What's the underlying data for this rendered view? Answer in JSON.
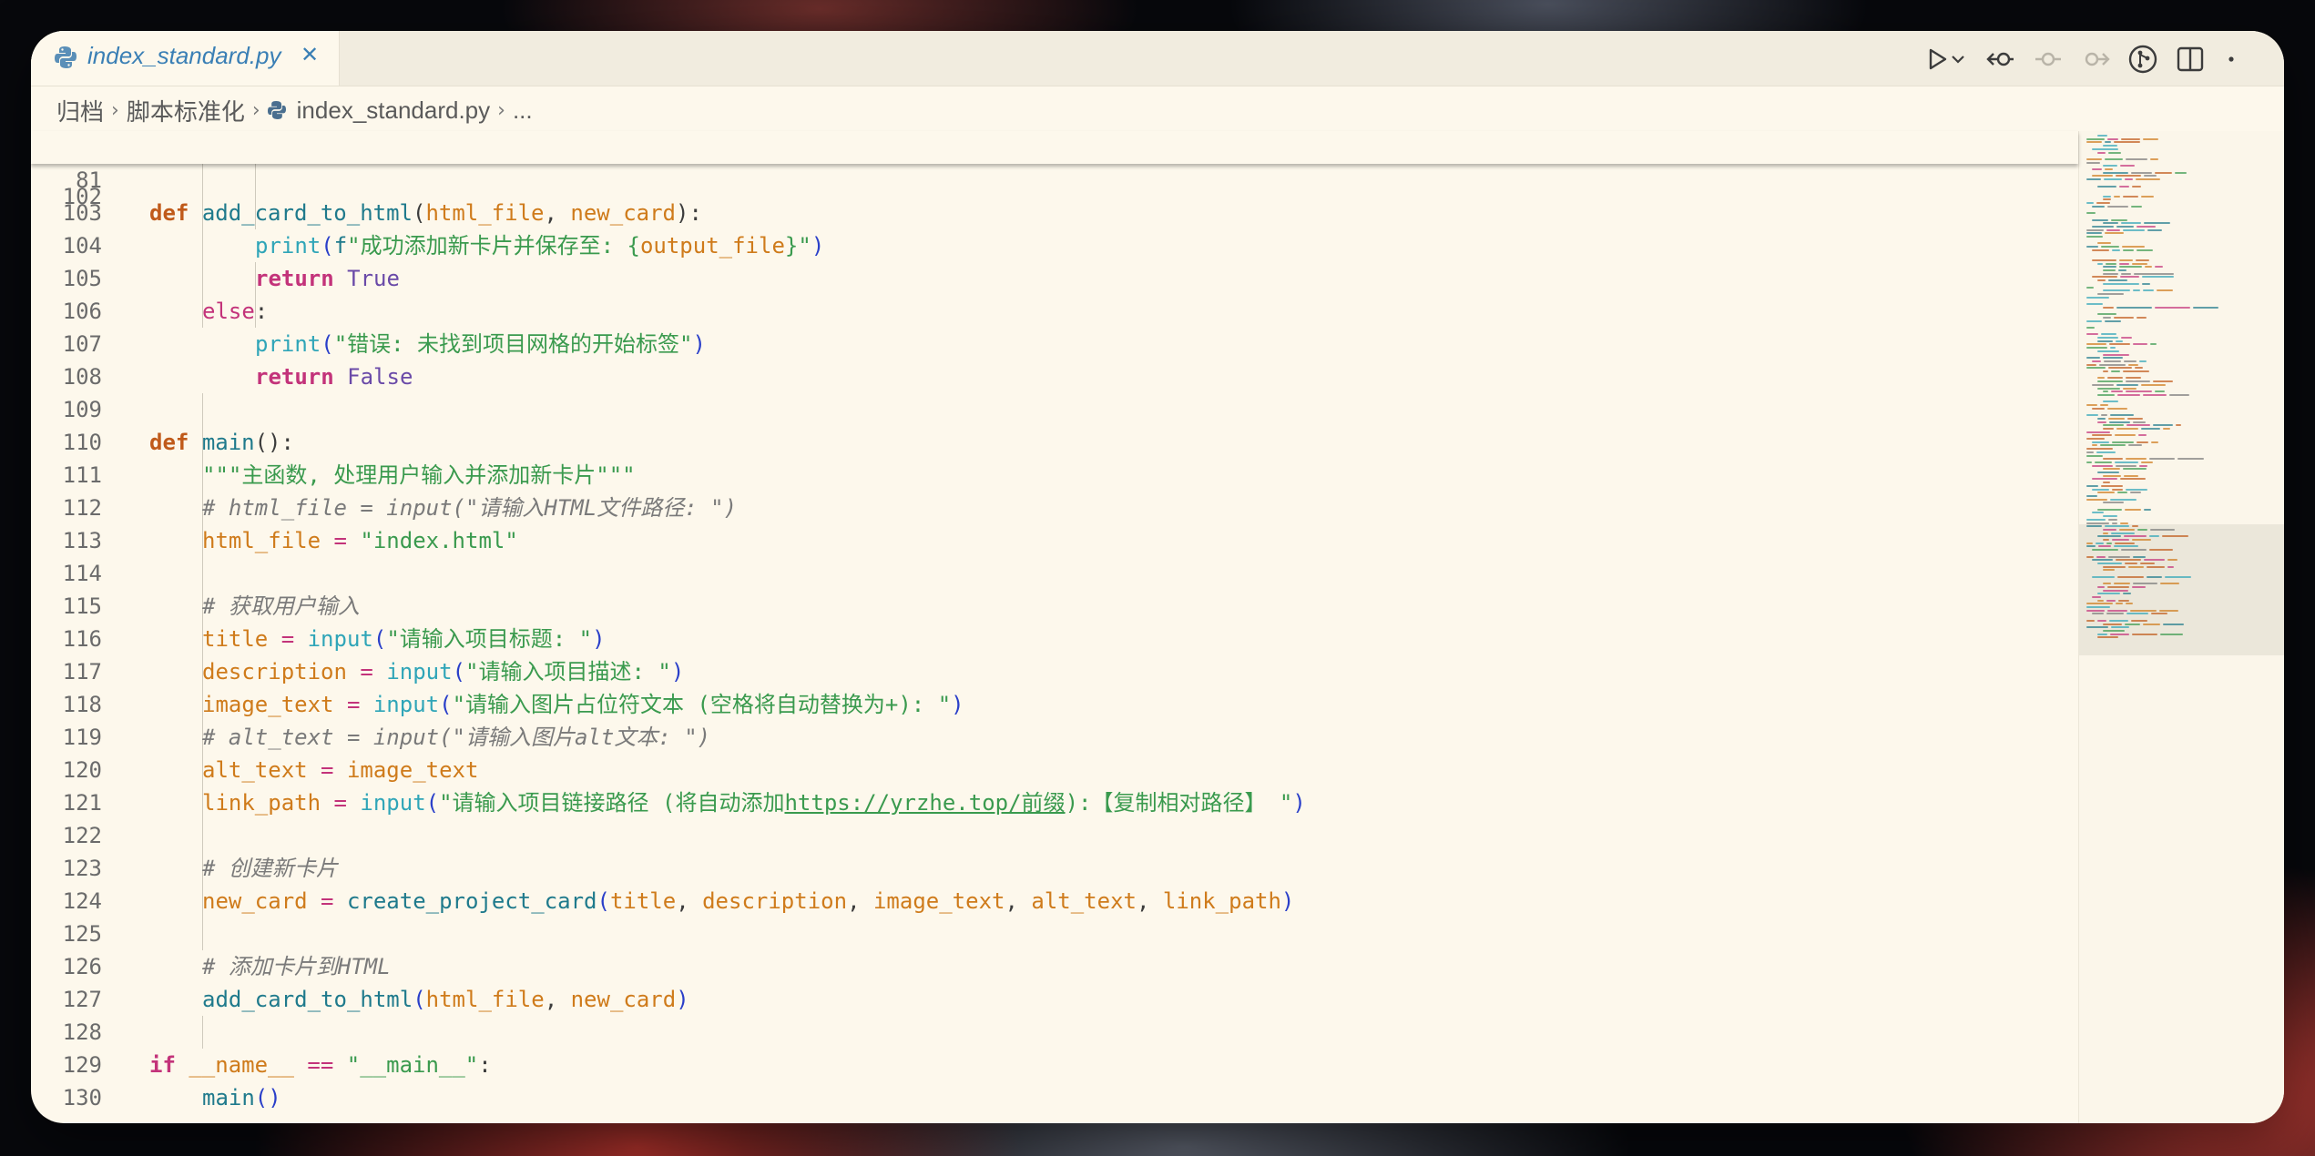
{
  "tab": {
    "title": "index_standard.py",
    "close": "✕"
  },
  "breadcrumb": {
    "items": [
      "归档",
      "脚本标准化",
      "index_standard.py",
      "..."
    ]
  },
  "sticky": {
    "line": "81"
  },
  "lines": [
    {
      "n": "102"
    },
    {
      "n": "103"
    },
    {
      "n": "104"
    },
    {
      "n": "105"
    },
    {
      "n": "106"
    },
    {
      "n": "107"
    },
    {
      "n": "108"
    },
    {
      "n": "109"
    },
    {
      "n": "110"
    },
    {
      "n": "111"
    },
    {
      "n": "112"
    },
    {
      "n": "113"
    },
    {
      "n": "114"
    },
    {
      "n": "115"
    },
    {
      "n": "116"
    },
    {
      "n": "117"
    },
    {
      "n": "118"
    },
    {
      "n": "119"
    },
    {
      "n": "120"
    },
    {
      "n": "121"
    },
    {
      "n": "122"
    },
    {
      "n": "123"
    },
    {
      "n": "124"
    },
    {
      "n": "125"
    },
    {
      "n": "126"
    },
    {
      "n": "127"
    },
    {
      "n": "128"
    },
    {
      "n": "129"
    },
    {
      "n": "130"
    }
  ],
  "code": {
    "def": "def",
    "add_card_to_html": "add_card_to_html",
    "html_file": "html_file",
    "new_card": "new_card",
    "print": "print",
    "f_prefix": "f",
    "success_msg": "\"成功添加新卡片并保存至: {",
    "output_file": "output_file",
    "success_end": "}\"",
    "return": "return",
    "true": "True",
    "false": "False",
    "else": "else",
    "error_msg": "\"错误: 未找到项目网格的开始标签\"",
    "main": "main",
    "docstring": "\"\"\"主函数, 处理用户输入并添加新卡片\"\"\"",
    "comment_111": "# html_file = input(\"请输入HTML文件路径: \")",
    "index_html": "\"index.html\"",
    "comment_114": "# 获取用户输入",
    "title": "title",
    "input": "input",
    "prompt_title": "\"请输入项目标题: \"",
    "description": "description",
    "prompt_desc": "\"请输入项目描述: \"",
    "image_text": "image_text",
    "prompt_image": "\"请输入图片占位符文本 (空格将自动替换为+): \"",
    "comment_118": "# alt_text = input(\"请输入图片alt文本: \")",
    "alt_text": "alt_text",
    "link_path": "link_path",
    "prompt_link_a": "\"请输入项目链接路径 (将自动添加",
    "prompt_link_url": "https://yrzhe.top/前缀",
    "prompt_link_b": "):【复制相对路径】 \"",
    "comment_122": "# 创建新卡片",
    "create_project_card": "create_project_card",
    "comment_125": "# 添加卡片到HTML",
    "if": "if",
    "dunder_name": "__name__",
    "eq": "==",
    "dunder_main": "\"__main__\""
  },
  "colors": {
    "background": "#fdf8ec",
    "keyword_def": "#c05a1a",
    "keyword_control": "#c3337a",
    "function": "#1f7a8c",
    "parameter": "#cf7b1b",
    "string": "#3a9a4e",
    "comment": "#7a7a7a",
    "bracket": "#2a3fc9",
    "accent": "#3a7fb5"
  },
  "icons": [
    "python-file-icon",
    "run-icon",
    "chevron-down-icon",
    "go-back-icon",
    "commit-icon",
    "go-forward-icon",
    "git-graph-icon",
    "split-editor-icon",
    "more-icon"
  ]
}
